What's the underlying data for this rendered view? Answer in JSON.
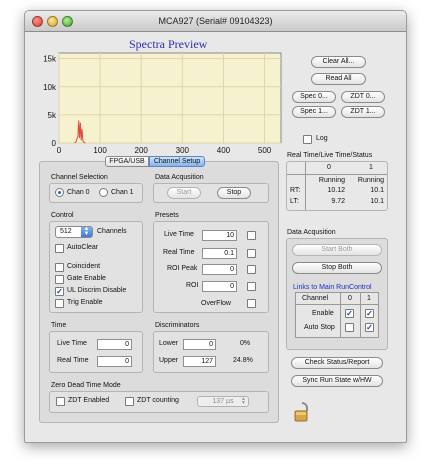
{
  "window": {
    "title": "MCA927 (Serial# 09104323)"
  },
  "spectra": {
    "title": "Spectra Preview",
    "y_ticks": [
      "15k",
      "10k",
      "5k",
      "0"
    ],
    "x_ticks": [
      "0",
      "100",
      "200",
      "300",
      "400",
      "500"
    ]
  },
  "chart_data": {
    "type": "line",
    "title": "Spectra Preview",
    "xlabel": "",
    "ylabel": "",
    "xlim": [
      0,
      540
    ],
    "ylim": [
      0,
      16000
    ],
    "grid": true,
    "legend": "none",
    "series": [
      {
        "values": [
          [
            38,
            0
          ],
          [
            42,
            300
          ],
          [
            44,
            800
          ],
          [
            46,
            1100
          ],
          [
            48,
            4000
          ],
          [
            50,
            900
          ],
          [
            52,
            3600
          ],
          [
            54,
            500
          ],
          [
            56,
            2500
          ],
          [
            58,
            400
          ],
          [
            60,
            150
          ],
          [
            64,
            0
          ]
        ]
      }
    ],
    "color": "#e04a3a"
  },
  "buttons": {
    "clear_all": "Clear All...",
    "read_all": "Read All",
    "spec0": "Spec 0...",
    "zdt0": "ZDT 0...",
    "spec1": "Spec 1...",
    "zdt1": "ZDT 1...",
    "check_status": "Check Status/Report",
    "sync_run": "Sync Run State w/HW"
  },
  "log": {
    "label": "Log",
    "checked": false
  },
  "status": {
    "title": "Real Time/Live Time/Status",
    "col0": "0",
    "col1": "1",
    "running0": "Running",
    "running1": "Running",
    "rt_label": "RT:",
    "rt0": "10.12",
    "rt1": "10.1",
    "lt_label": "LT:",
    "lt0": "9.72",
    "lt1": "10.1"
  },
  "tabs": {
    "fpga": "FPGA/USB",
    "channel_setup": "Channel Setup"
  },
  "channel_selection": {
    "title": "Channel Selection",
    "chan0": "Chan 0",
    "chan1": "Chan 1",
    "selected": "Chan 0"
  },
  "data_acq_left": {
    "title": "Data Acqusition",
    "start": "Start",
    "stop": "Stop"
  },
  "control": {
    "title": "Control",
    "channels_value": "512",
    "channels_label": "Channels",
    "autoclear": "AutoClear",
    "coincident": "Coincident",
    "gate_enable": "Gate Enable",
    "ul_discrim": "UL Discrim Disable",
    "trig_enable": "Trig Enable",
    "checks": {
      "autoclear": false,
      "coincident": false,
      "gate_enable": false,
      "ul_discrim": true,
      "trig_enable": false
    }
  },
  "presets": {
    "title": "Presets",
    "live_time_label": "Live Time",
    "live_time": "10",
    "real_time_label": "Real Time",
    "real_time": "0.1",
    "roi_peak_label": "ROI Peak",
    "roi_peak": "0",
    "roi_label": "ROI",
    "roi": "0",
    "overflow_label": "OverFlow"
  },
  "time": {
    "title": "Time",
    "live_time_label": "Live Time",
    "live_time": "0",
    "real_time_label": "Real Time",
    "real_time": "0"
  },
  "discriminators": {
    "title": "Discriminators",
    "lower_label": "Lower",
    "lower": "0",
    "lower_pct": "0%",
    "upper_label": "Upper",
    "upper": "127",
    "upper_pct": "24.8%"
  },
  "zdt": {
    "title": "Zero Dead Time Mode",
    "enabled": "ZDT Enabled",
    "counting": "ZDT counting",
    "interval": "137 µs"
  },
  "data_acq_right": {
    "title": "Data Acqusition",
    "start_both": "Start  Both",
    "stop_both": "Stop Both",
    "links": "Links to Main RunControl",
    "channel_label": "Channel",
    "ch0": "0",
    "ch1": "1",
    "enable_label": "Enable",
    "autostop_label": "Auto Stop",
    "enable0": true,
    "enable1": true,
    "autostop0": false,
    "autostop1": true
  }
}
